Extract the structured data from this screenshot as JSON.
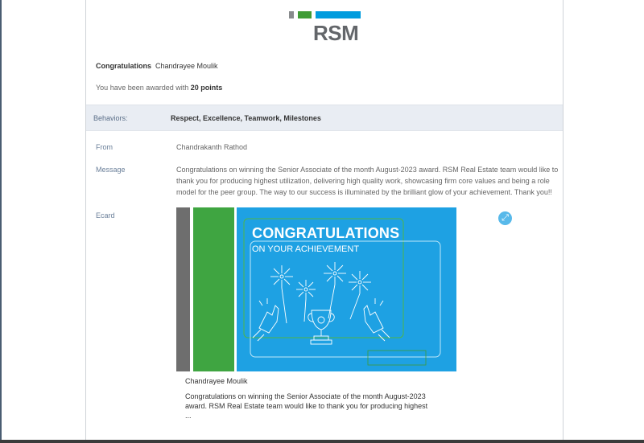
{
  "brand": {
    "logo_text": "RSM",
    "colors": {
      "gray": "#888b8d",
      "green": "#3f9c35",
      "blue": "#009cde"
    }
  },
  "award": {
    "congrats_label": "Congratulations",
    "recipient": "Chandrayee Moulik",
    "awarded_prefix": "You have been awarded with",
    "points": "20 points"
  },
  "behaviors": {
    "label": "Behaviors:",
    "value": "Respect, Excellence, Teamwork, Milestones"
  },
  "details": {
    "from_label": "From",
    "from_value": "Chandrakanth Rathod",
    "message_label": "Message",
    "message_value": "Congratulations on winning the Senior Associate of the month August-2023 award. RSM Real Estate team would like to thank you for producing highest utilization, delivering high quality work, showcasing firm core values and being a role model for the peer group. The way to our success is illuminated by the brilliant glow of your achievement. Thank you!!",
    "ecard_label": "Ecard"
  },
  "ecard": {
    "title": "CONGRATULATIONS",
    "subtitle": "ON YOUR ACHIEVEMENT",
    "expand_icon": "expand-icon",
    "caption_name": "Chandrayee Moulik",
    "caption_text": "Congratulations on winning the Senior Associate of the month August-2023 award. RSM Real Estate team would like to thank you for producing highest ..."
  }
}
